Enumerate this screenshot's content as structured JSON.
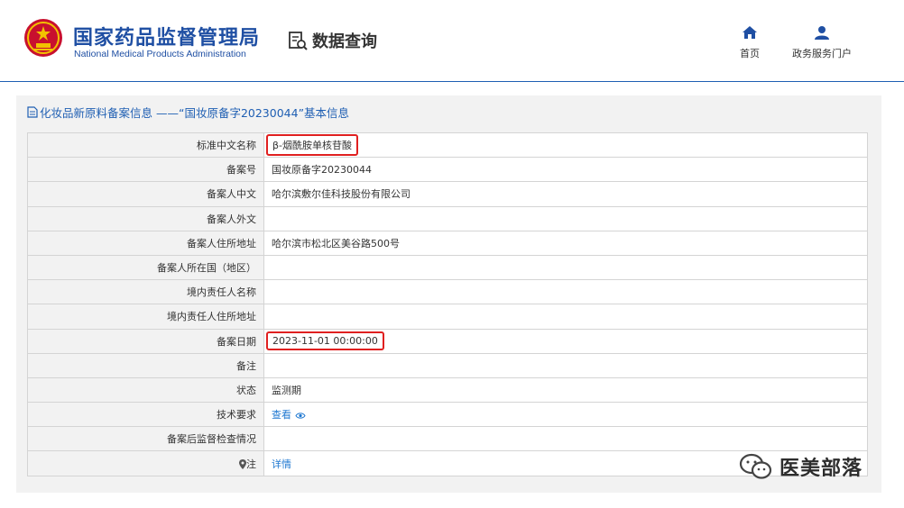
{
  "header": {
    "org_name_cn": "国家药品监督管理局",
    "org_name_en": "National Medical Products Administration",
    "data_query_label": "数据查询",
    "nav": [
      {
        "label": "首页",
        "icon": "home-icon"
      },
      {
        "label": "政务服务门户",
        "icon": "user-icon"
      }
    ]
  },
  "panel": {
    "title": "化妆品新原料备案信息 ——“国妆原备字20230044”基本信息",
    "rows": [
      {
        "label": "标准中文名称",
        "value": "β-烟酰胺单核苷酸"
      },
      {
        "label": "备案号",
        "value": "国妆原备字20230044"
      },
      {
        "label": "备案人中文",
        "value": "哈尔滨敷尔佳科技股份有限公司"
      },
      {
        "label": "备案人外文",
        "value": ""
      },
      {
        "label": "备案人住所地址",
        "value": "哈尔滨市松北区美谷路500号"
      },
      {
        "label": "备案人所在国（地区）",
        "value": ""
      },
      {
        "label": "境内责任人名称",
        "value": ""
      },
      {
        "label": "境内责任人住所地址",
        "value": ""
      },
      {
        "label": "备案日期",
        "value": "2023-11-01 00:00:00"
      },
      {
        "label": "备注",
        "value": ""
      },
      {
        "label": "状态",
        "value": "监测期"
      },
      {
        "label": "技术要求",
        "value": "查看"
      },
      {
        "label": "备案后监督检查情况",
        "value": ""
      },
      {
        "label": "注",
        "value": "详情"
      }
    ]
  },
  "watermark": {
    "text": "医美部落",
    "icon": "wechat-icon"
  },
  "colors": {
    "brand_blue": "#1f4fa3",
    "link_blue": "#1f78d1",
    "highlight_red": "#e02020"
  }
}
